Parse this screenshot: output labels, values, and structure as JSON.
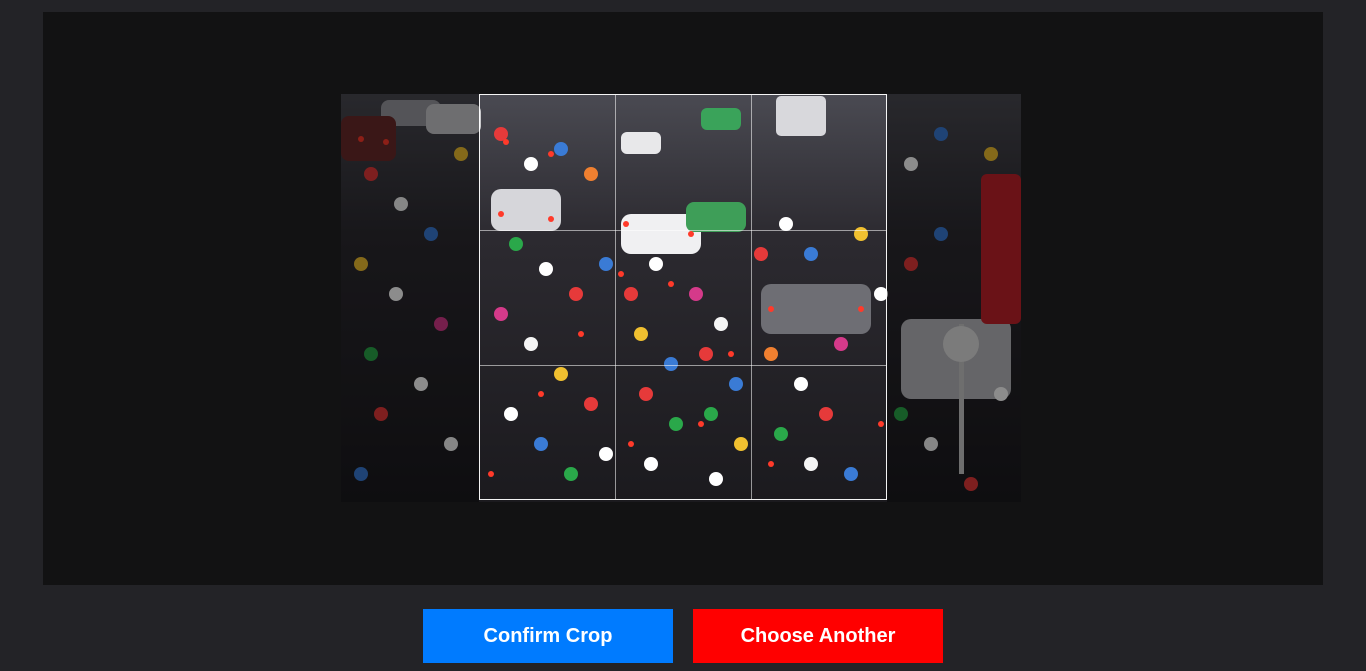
{
  "cropper": {
    "image_alt": "Crowded street traffic with many motorbikes and cars"
  },
  "actions": {
    "confirm_label": "Confirm Crop",
    "choose_label": "Choose Another"
  },
  "colors": {
    "page_bg": "#232327",
    "stage_bg": "#121213",
    "confirm_bg": "#007bff",
    "choose_bg": "#ff0000"
  }
}
